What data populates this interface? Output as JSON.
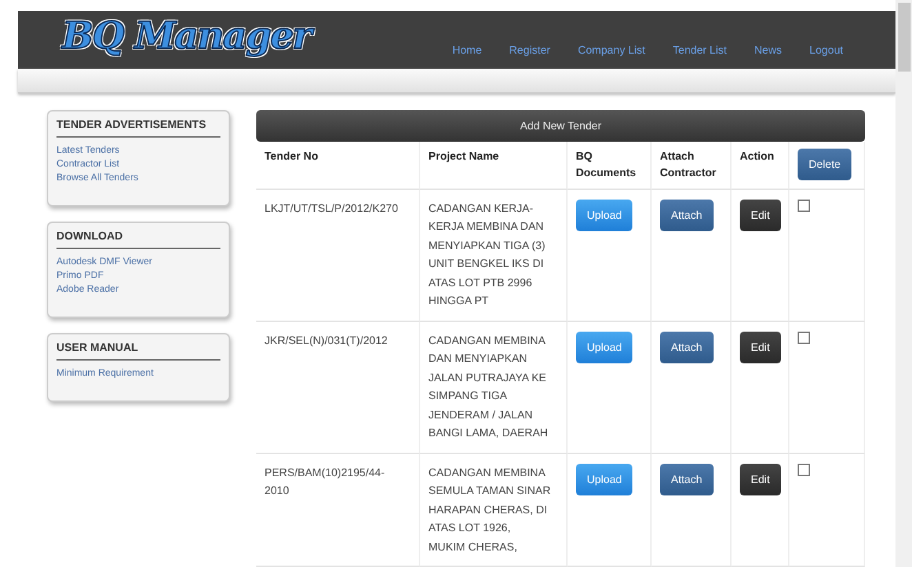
{
  "logo": "BQ Manager",
  "nav": [
    "Home",
    "Register",
    "Company List",
    "Tender List",
    "News",
    "Logout"
  ],
  "sidebar": [
    {
      "title": "TENDER ADVERTISEMENTS",
      "links": [
        "Latest Tenders",
        "Contractor List",
        "Browse All Tenders"
      ]
    },
    {
      "title": "DOWNLOAD",
      "links": [
        "Autodesk DMF Viewer",
        "Primo PDF",
        "Adobe Reader"
      ]
    },
    {
      "title": "USER MANUAL",
      "links": [
        "Minimum Requirement"
      ]
    }
  ],
  "add_button": "Add New Tender",
  "columns": [
    "Tender No",
    "Project Name",
    "BQ\nDocuments",
    "Attach\nContractor",
    "Action"
  ],
  "delete_button": "Delete",
  "rows": [
    {
      "tender_no": "LKJT/UT/TSL/P/2012/K270",
      "project": "CADANGAN KERJA-\nKERJA MEMBINA DAN\nMENYIAPKAN TIGA (3)\nUNIT BENGKEL IKS DI\nATAS LOT PTB 2996\nHINGGA PT",
      "upload": "Upload",
      "attach": "Attach",
      "edit": "Edit",
      "checked": false
    },
    {
      "tender_no": "JKR/SEL(N)/031(T)/2012",
      "project": "CADANGAN MEMBINA\nDAN MENYIAPKAN\nJALAN PUTRAJAYA KE\nSIMPANG TIGA\nJENDERAM / JALAN\nBANGI LAMA, DAERAH",
      "upload": "Upload",
      "attach": "Attach",
      "edit": "Edit",
      "checked": false
    },
    {
      "tender_no": "PERS/BAM(10)2195/44-\n2010",
      "project": "CADANGAN MEMBINA\nSEMULA TAMAN SINAR\nHARAPAN CHERAS, DI\nATAS LOT 1926,\nMUKIM CHERAS,",
      "upload": "Upload",
      "attach": "Attach",
      "edit": "Edit",
      "checked": false
    }
  ]
}
